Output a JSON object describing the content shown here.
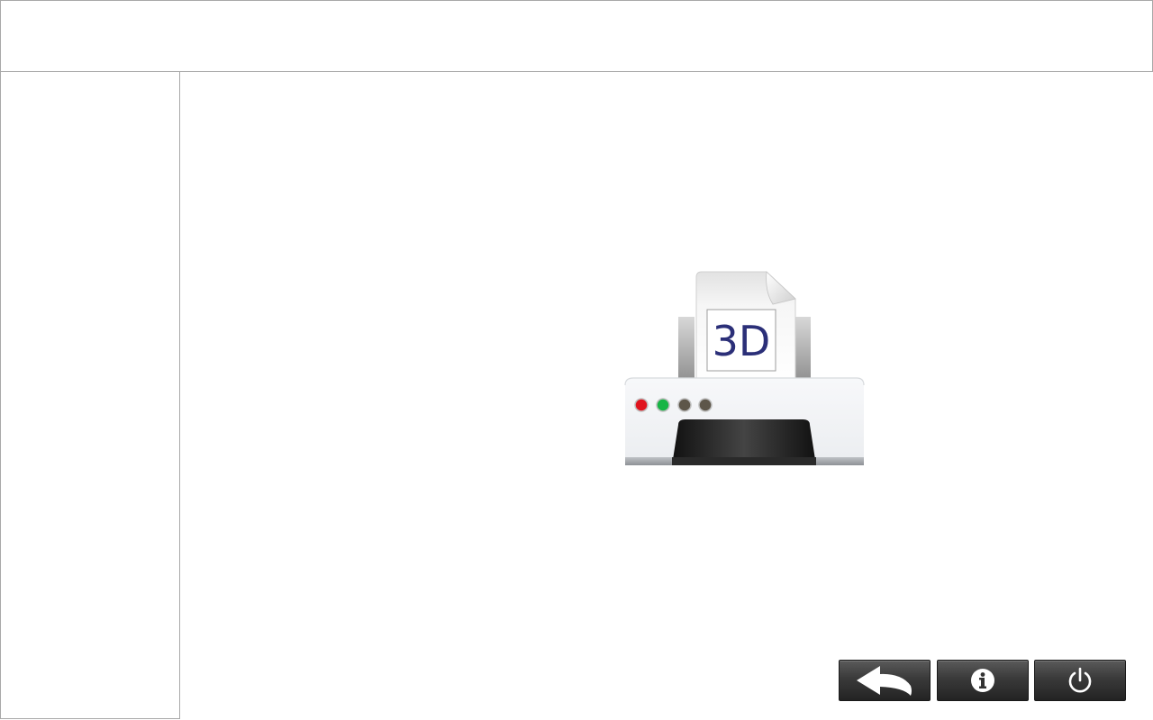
{
  "header": {
    "title": ""
  },
  "sidebar": {
    "label": ""
  },
  "main": {
    "heading": "",
    "illustration": {
      "icon": "3d-printer-icon",
      "paper_label": "3D",
      "paper_label_color": "#2b2f78",
      "indicator_lights": [
        "#e0141e",
        "#17b545",
        "#5d5649",
        "#5d5649"
      ]
    }
  },
  "toolbar": {
    "buttons": [
      {
        "name": "back",
        "icon": "back-arrow-icon"
      },
      {
        "name": "info",
        "icon": "info-icon"
      },
      {
        "name": "power",
        "icon": "power-icon"
      }
    ]
  }
}
